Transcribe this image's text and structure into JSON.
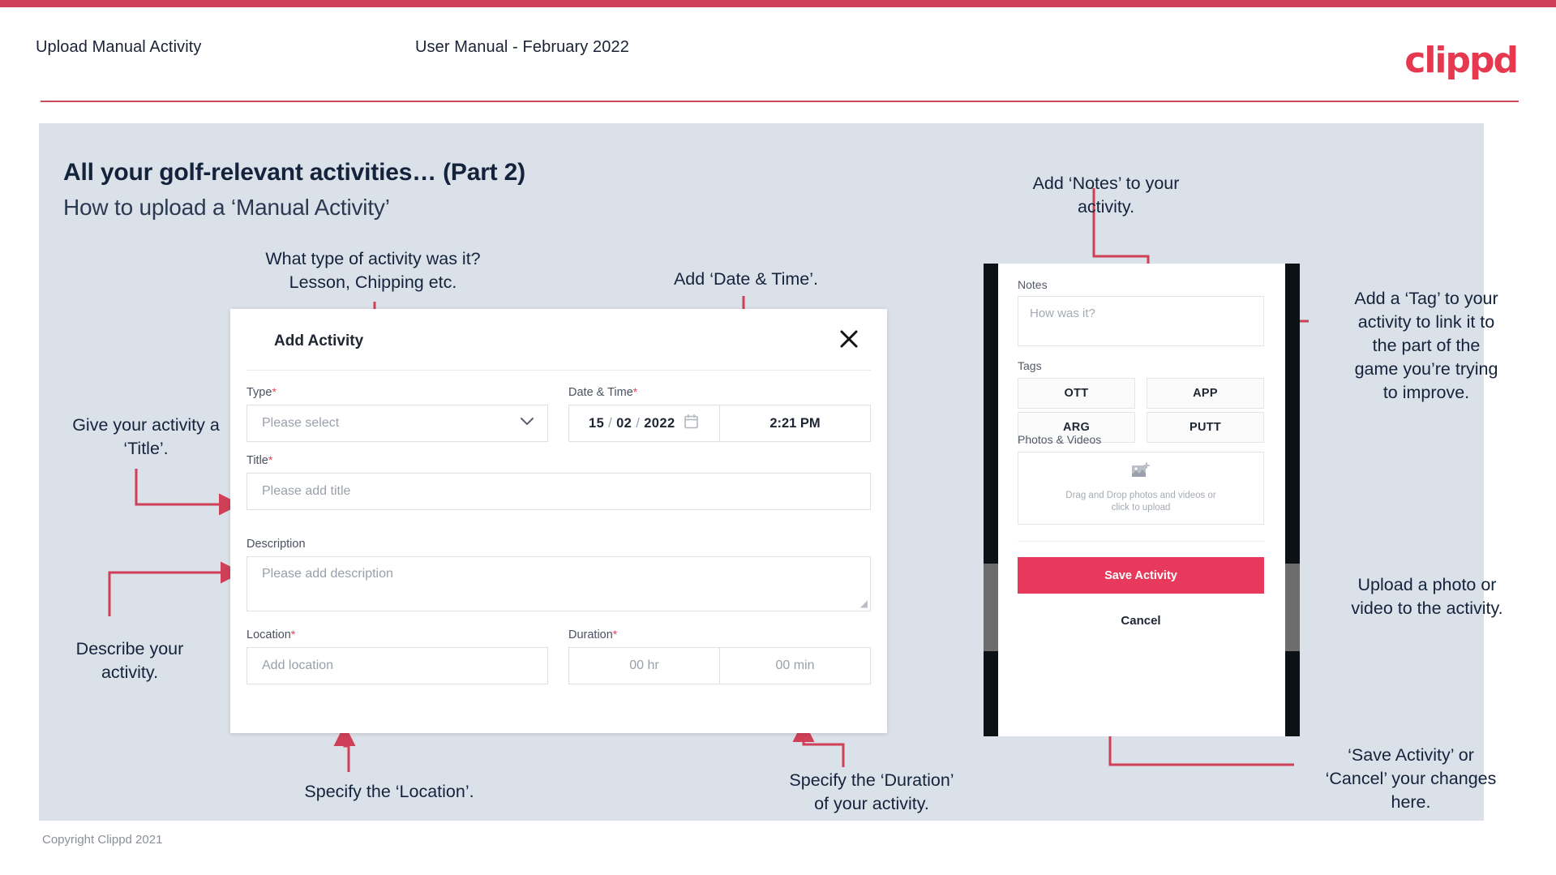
{
  "header": {
    "left_title": "Upload Manual Activity",
    "center_title": "User Manual - February 2022",
    "logo": "clippd"
  },
  "slide": {
    "title_line1": "All your golf-relevant activities… (Part 2)",
    "title_line2": "How to upload a ‘Manual Activity’"
  },
  "footer": {
    "copyright": "Copyright Clippd 2021"
  },
  "dialog": {
    "title": "Add Activity",
    "close_icon": "close-icon",
    "fields": {
      "type_label": "Type",
      "type_placeholder": "Please select",
      "datetime_label": "Date & Time",
      "date_day": "15",
      "date_month": "02",
      "date_year": "2022",
      "time_value": "2:21 PM",
      "title_label": "Title",
      "title_placeholder": "Please add title",
      "description_label": "Description",
      "description_placeholder": "Please add description",
      "location_label": "Location",
      "location_placeholder": "Add location",
      "duration_label": "Duration",
      "duration_hours": "00 hr",
      "duration_minutes": "00 min",
      "required_mark": "*"
    }
  },
  "phone": {
    "notes_label": "Notes",
    "notes_placeholder": "How was it?",
    "tags_label": "Tags",
    "tags": [
      "OTT",
      "APP",
      "ARG",
      "PUTT"
    ],
    "photos_label": "Photos & Videos",
    "upload_line1": "Drag and Drop photos and videos or",
    "upload_line2": "click to upload",
    "save_label": "Save Activity",
    "cancel_label": "Cancel"
  },
  "annotations": {
    "type": "What type of activity was it?\nLesson, Chipping etc.",
    "datetime": "Add ‘Date & Time’.",
    "title": "Give your activity a\n‘Title’.",
    "description": "Describe your\nactivity.",
    "location": "Specify the ‘Location’.",
    "duration": "Specify the ‘Duration’\nof your activity.",
    "notes": "Add ‘Notes’ to your\nactivity.",
    "tags": "Add a ‘Tag’ to your\nactivity to link it to\nthe part of the\ngame you’re trying\nto improve.",
    "upload": "Upload a photo or\nvideo to the activity.",
    "save": "‘Save Activity’ or\n‘Cancel’ your changes\nhere."
  },
  "colors": {
    "brand_red": "#e63950",
    "accent_pink": "#e7395b",
    "arrow_red": "#cf4058",
    "slide_bg": "#dbe1e8",
    "text_dark": "#14233c"
  }
}
